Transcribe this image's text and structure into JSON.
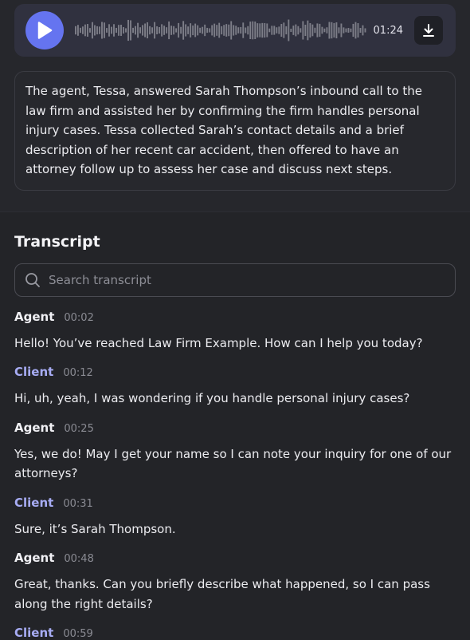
{
  "player": {
    "duration": "01:24",
    "play_icon": "play-icon",
    "download_icon": "download-icon",
    "accent": "#6574f0"
  },
  "summary": "The agent, Tessa, answered Sarah Thompson’s inbound call to the law firm and assisted her by confirming the firm handles personal injury cases. Tessa collected Sarah’s contact details and a brief description of her recent car accident, then offered to have an attorney follow up to assess her case and discuss next steps.",
  "transcript": {
    "title": "Transcript",
    "search_placeholder": "Search transcript",
    "messages": [
      {
        "speaker": "Agent",
        "time": "00:02",
        "text": "Hello! You’ve reached Law Firm Example. How can I help you today?"
      },
      {
        "speaker": "Client",
        "time": "00:12",
        "text": "Hi, uh, yeah, I was wondering if you handle personal injury cases?"
      },
      {
        "speaker": "Agent",
        "time": "00:25",
        "text": "Yes, we do! May I get your name so I can note your inquiry for one of our attorneys?"
      },
      {
        "speaker": "Client",
        "time": "00:31",
        "text": "Sure, it’s Sarah Thompson."
      },
      {
        "speaker": "Agent",
        "time": "00:48",
        "text": "Great, thanks. Can you briefly describe what happened, so I can pass along the right details?"
      },
      {
        "speaker": "Client",
        "time": "00:59",
        "text": ""
      }
    ]
  }
}
